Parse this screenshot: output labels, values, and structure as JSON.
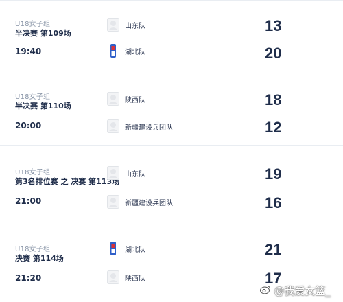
{
  "matches": [
    {
      "group": "U18女子组",
      "stage": "半决赛 第109场",
      "time": "19:40",
      "team1": {
        "name": "山东队",
        "logo": "placeholder-logo-icon"
      },
      "team2": {
        "name": "湖北队",
        "logo": "hubei-logo-icon"
      },
      "score1": "13",
      "score2": "20"
    },
    {
      "group": "U18女子组",
      "stage": "半决赛 第110场",
      "time": "20:00",
      "team1": {
        "name": "陕西队",
        "logo": "placeholder-logo-icon"
      },
      "team2": {
        "name": "新疆建设兵团队",
        "logo": "placeholder-logo-icon"
      },
      "score1": "18",
      "score2": "12"
    },
    {
      "group": "U18女子组",
      "stage": "第3名排位赛 之 决赛 第113场",
      "time": "21:00",
      "team1": {
        "name": "山东队",
        "logo": "placeholder-logo-icon"
      },
      "team2": {
        "name": "新疆建设兵团队",
        "logo": "placeholder-logo-icon"
      },
      "score1": "19",
      "score2": "16"
    },
    {
      "group": "U18女子组",
      "stage": "决赛 第114场",
      "time": "21:20",
      "team1": {
        "name": "湖北队",
        "logo": "hubei-logo-icon"
      },
      "team2": {
        "name": "陕西队",
        "logo": "placeholder-logo-icon"
      },
      "score1": "21",
      "score2": "17"
    }
  ],
  "watermark": {
    "text": "@我爱女篮_",
    "icon": "weibo-logo-icon"
  },
  "colors": {
    "text_dark": "#1f2d4a",
    "text_muted": "#8a96a8",
    "divider": "#e9edf2",
    "hubei_blue": "#2f5fc9",
    "hubei_red": "#d8333a"
  }
}
